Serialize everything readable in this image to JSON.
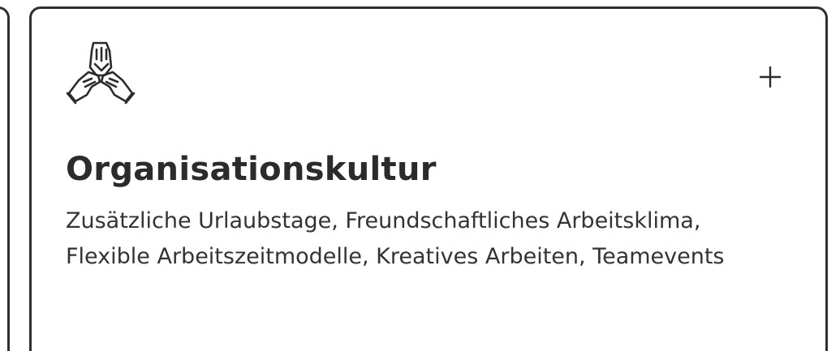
{
  "card": {
    "icon": "joined-hands-icon",
    "title": "Organisationskultur",
    "description": "Zusätzliche Urlaubstage, Freundschaftliches Arbeitsklima, Flexible Arbeitszeitmodelle, Kreatives Arbeiten, Teamevents",
    "expand_icon": "plus-icon"
  },
  "colors": {
    "border": "#2f2f2f",
    "text": "#2b2b2b",
    "background": "#ffffff"
  }
}
